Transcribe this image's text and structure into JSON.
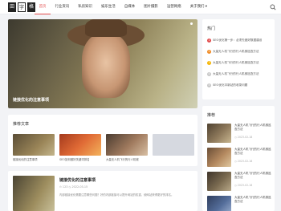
{
  "logo": [
    "田",
    "字",
    "格"
  ],
  "nav": [
    "首页",
    "行业资讯",
    "私房知识",
    "娱乐生活",
    "自媒体",
    "图片摄影",
    "运营网络",
    "关于我们 ▾"
  ],
  "hero": {
    "title": "链接优化的注意事项"
  },
  "hot": {
    "title": "热门",
    "items": [
      {
        "num": "1",
        "text": "SEO优化第一步：必须先做好数据建设",
        "color": "#e24a4a"
      },
      {
        "num": "2",
        "text": "大量无人机飞行的行人机械巡查方法",
        "color": "#f08a24"
      },
      {
        "num": "3",
        "text": "大量无人机飞行的行人机械巡查方法",
        "color": "#f5b400"
      },
      {
        "num": "4",
        "text": "大量无人机飞行的行人机械巡查方法",
        "color": "#c7c7c7"
      },
      {
        "num": "5",
        "text": "SEO优化中新站的收录问题",
        "color": "#c7c7c7"
      }
    ]
  },
  "recommend": {
    "title": "推荐文章",
    "items": [
      {
        "text": "链接优化的注意事项",
        "color": "#8a7a55"
      },
      {
        "text": "SEO如何做好关键词排名",
        "color": "#d35b32"
      },
      {
        "text": "大量无人机飞行的行人机械",
        "color": "#a07a5e"
      },
      {
        "text": "",
        "color": "#d6d9e0"
      }
    ]
  },
  "article": {
    "title": "链接优化的注意事项",
    "meta": "⊙ 123  ◷ 2022-03-15",
    "excerpt": "内部链接优化需要注意哪些问题？好的内部链接可以提升网站的权重，使网站获得更好的排名。"
  },
  "recom": {
    "title": "推荐",
    "items": [
      {
        "text": "大量无人机飞行的行人机械巡查方法",
        "date": "◷ 2023-02-18",
        "color": "#8f7a5c"
      },
      {
        "text": "大量无人机飞行的行人机械巡查方法",
        "date": "◷ 2023-02-18",
        "color": "#b58a60"
      },
      {
        "text": "大量无人机飞行的行人机械巡查方法",
        "date": "◷ 2023-02-18",
        "color": "#7a6a50"
      },
      {
        "text": "大量无人机飞行的行人机械巡查方法",
        "date": "",
        "color": "#546d9a"
      }
    ]
  }
}
